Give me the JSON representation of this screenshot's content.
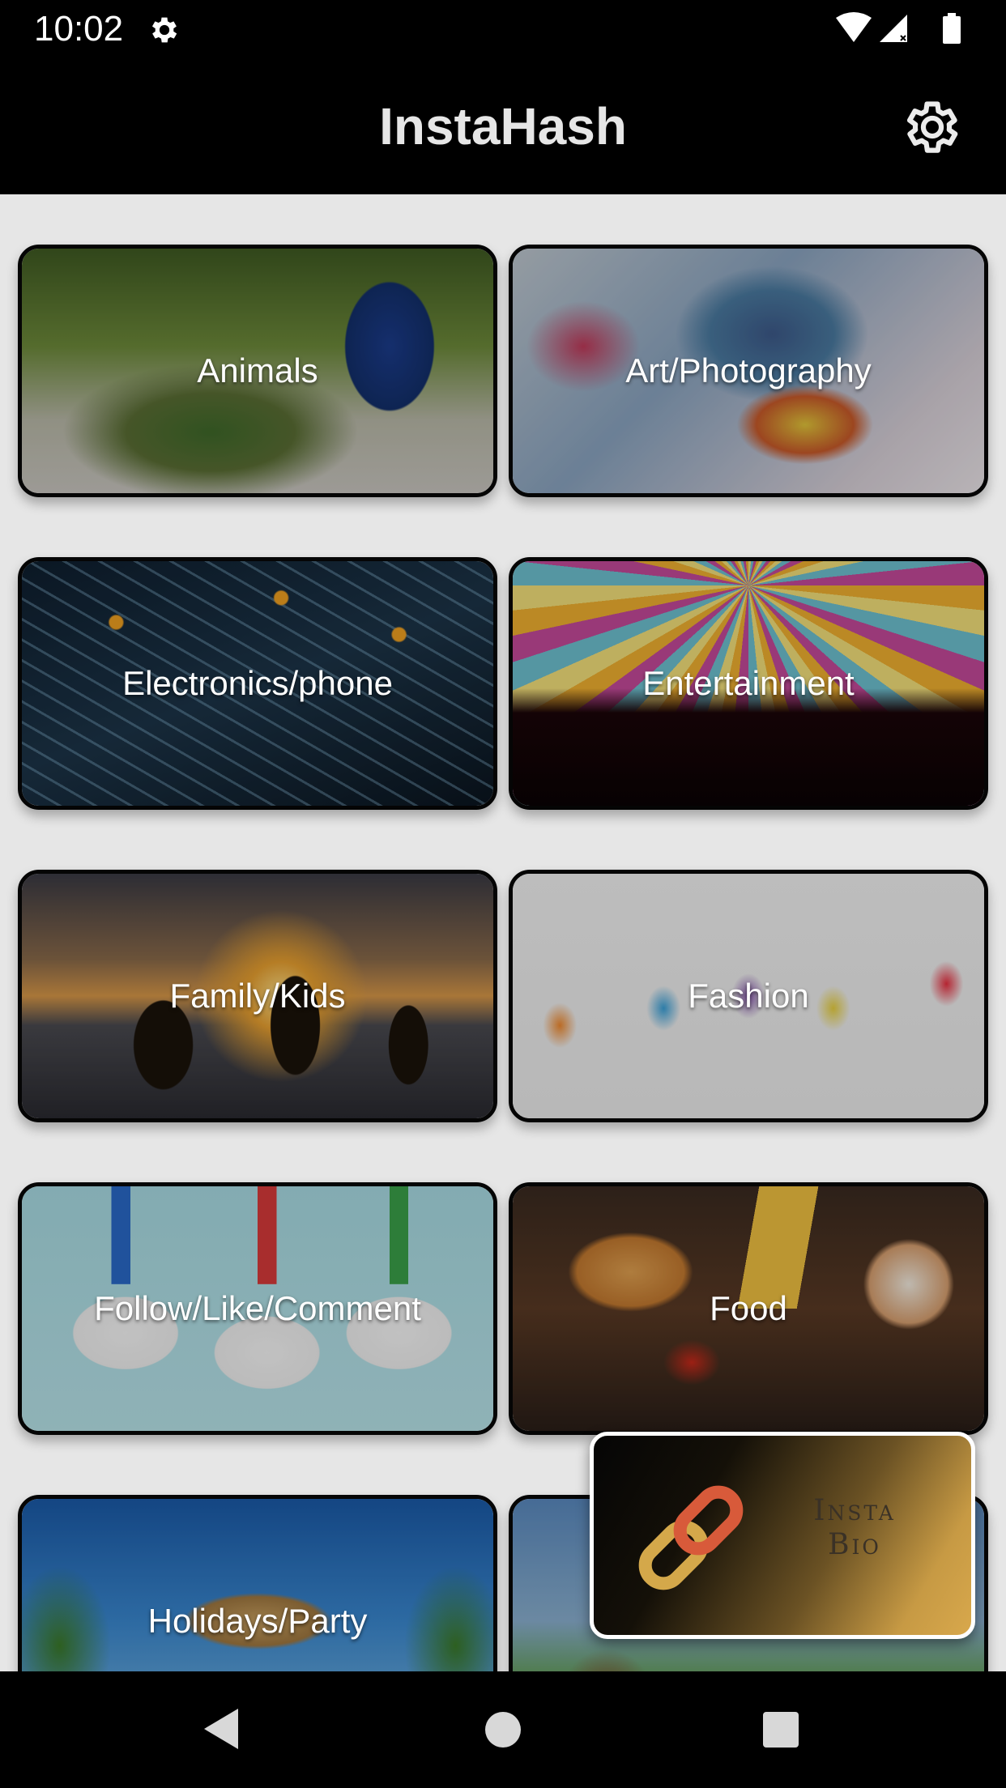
{
  "status_bar": {
    "time": "10:02",
    "icons": [
      "settings-icon",
      "wifi-icon",
      "signal-icon",
      "battery-icon"
    ]
  },
  "app_bar": {
    "title": "InstaHash",
    "settings_icon": "gear-icon"
  },
  "categories": [
    {
      "label": "Animals",
      "image": "peacock"
    },
    {
      "label": "Art/Photography",
      "image": "painted-horse"
    },
    {
      "label": "Electronics/phone",
      "image": "circuit-board"
    },
    {
      "label": "Entertainment",
      "image": "concert-crowd"
    },
    {
      "label": "Family/Kids",
      "image": "family-silhouette-sunset"
    },
    {
      "label": "Fashion",
      "image": "shopping-women"
    },
    {
      "label": "Follow/Like/Comment",
      "image": "like-share-follow-notes"
    },
    {
      "label": "Food",
      "image": "burger-fries-donut"
    },
    {
      "label": "Holidays/Party",
      "image": "beach-hut"
    },
    {
      "label": "",
      "image": "landscape"
    }
  ],
  "insta_bio": {
    "line1": "Insta",
    "line2": "Bio",
    "icon": "link-icon"
  },
  "nav_bar": {
    "icons": [
      "back-icon",
      "home-icon",
      "recents-icon"
    ]
  },
  "colors": {
    "bars": "#000000",
    "background": "#e6e6e6",
    "title": "#e6e6e6",
    "card_border": "#050505",
    "bio_gold": "#d8a84c"
  }
}
